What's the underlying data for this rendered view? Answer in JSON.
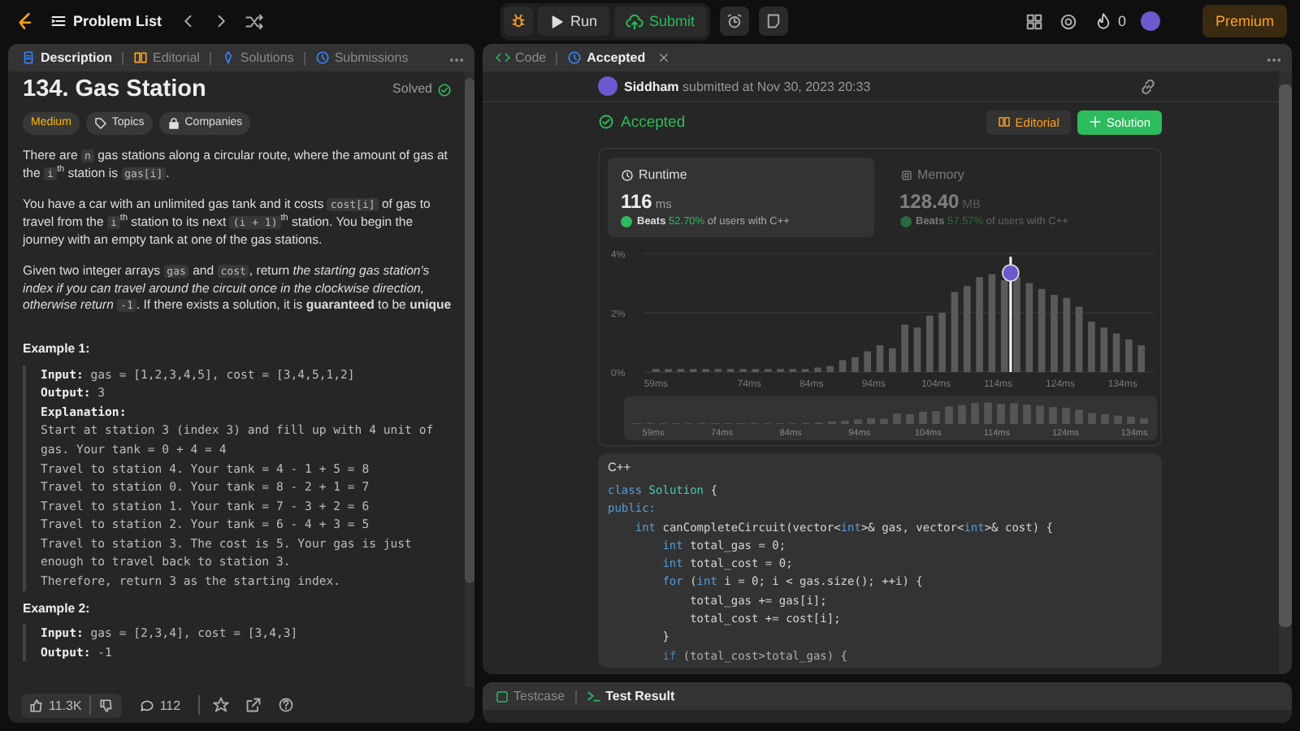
{
  "top_bar": {
    "problem_list": "Problem List",
    "run": "Run",
    "submit": "Submit",
    "streak": "0",
    "premium": "Premium"
  },
  "left_panel": {
    "tabs": [
      {
        "label": "Description",
        "selected": true
      },
      {
        "label": "Editorial",
        "selected": false
      },
      {
        "label": "Solutions",
        "selected": false
      },
      {
        "label": "Submissions",
        "selected": false
      }
    ],
    "title": "134. Gas Station",
    "status": "Solved",
    "difficulty": "Medium",
    "tags": [
      "Topics",
      "Companies"
    ],
    "paragraphs": [
      [
        {
          "text": "There are ",
          "kind": "text"
        },
        {
          "text": "n",
          "kind": "code"
        },
        {
          "text": " gas stations along a circular route, where the amount of gas at the ",
          "kind": "text"
        },
        {
          "text": "i",
          "kind": "code"
        },
        {
          "text": "th",
          "kind": "sup"
        },
        {
          "text": " station is ",
          "kind": "text"
        },
        {
          "text": "gas[i]",
          "kind": "code"
        },
        {
          "text": ".",
          "kind": "text"
        }
      ],
      [
        {
          "text": "You have a car with an unlimited gas tank and it costs ",
          "kind": "text"
        },
        {
          "text": "cost[i]",
          "kind": "code"
        },
        {
          "text": " of gas to travel from the ",
          "kind": "text"
        },
        {
          "text": "i",
          "kind": "code"
        },
        {
          "text": "th",
          "kind": "sup"
        },
        {
          "text": " station to its next ",
          "kind": "text"
        },
        {
          "text": "(i + 1)",
          "kind": "code"
        },
        {
          "text": "th",
          "kind": "sup"
        },
        {
          "text": " station. You begin the journey with an empty tank at one of the gas stations.",
          "kind": "text"
        }
      ],
      [
        {
          "text": "Given two integer arrays ",
          "kind": "text"
        },
        {
          "text": "gas",
          "kind": "code"
        },
        {
          "text": " and ",
          "kind": "text"
        },
        {
          "text": "cost",
          "kind": "code"
        },
        {
          "text": ", return ",
          "kind": "text"
        },
        {
          "text": "the starting gas station's index if you can travel around the circuit once in the clockwise direction, otherwise return ",
          "kind": "italic"
        },
        {
          "text": "-1",
          "kind": "code"
        },
        {
          "text": ". If there exists a solution, it is ",
          "kind": "text"
        },
        {
          "text": "guaranteed",
          "kind": "bold"
        },
        {
          "text": " to be ",
          "kind": "text"
        },
        {
          "text": "unique",
          "kind": "bold"
        }
      ]
    ],
    "examples": [
      {
        "heading": "Example 1:",
        "lines": [
          {
            "label": "Input:",
            "text": " gas = [1,2,3,4,5], cost = [3,4,5,1,2]"
          },
          {
            "label": "Output:",
            "text": " 3"
          },
          {
            "label": "Explanation:"
          },
          {
            "text": "Start at station 3 (index 3) and fill up with 4 unit of"
          },
          {
            "text": "gas. Your tank = 0 + 4 = 4"
          },
          {
            "text": "Travel to station 4. Your tank = 4 - 1 + 5 = 8"
          },
          {
            "text": "Travel to station 0. Your tank = 8 - 2 + 1 = 7"
          },
          {
            "text": "Travel to station 1. Your tank = 7 - 3 + 2 = 6"
          },
          {
            "text": "Travel to station 2. Your tank = 6 - 4 + 3 = 5"
          },
          {
            "text": "Travel to station 3. The cost is 5. Your gas is just"
          },
          {
            "text": "enough to travel back to station 3."
          },
          {
            "text": "Therefore, return 3 as the starting index."
          }
        ]
      },
      {
        "heading": "Example 2:",
        "lines": [
          {
            "label": "Input:",
            "text": " gas = [2,3,4], cost = [3,4,3]"
          },
          {
            "label": "Output:",
            "text": " -1"
          }
        ]
      }
    ],
    "footer": {
      "likes": "11.3K",
      "comments": "112"
    }
  },
  "right_panel": {
    "tabs": [
      {
        "label": "Code",
        "selected": false
      },
      {
        "label": "Accepted",
        "selected": true
      }
    ],
    "submitter": "Siddham",
    "submitted_text": "submitted at Nov 30, 2023 20:33",
    "status": "Accepted",
    "editorial_button": "Editorial",
    "solution_button": "Solution",
    "stats": [
      {
        "title": "Runtime",
        "value": "116",
        "unit": "ms",
        "beats_label": "Beats",
        "percent": "52.70%",
        "suffix": "of users with C++",
        "selected": true
      },
      {
        "title": "Memory",
        "value": "128.40",
        "unit": "MB",
        "beats_label": "Beats",
        "percent": "57.57%",
        "suffix": "of users with C++",
        "selected": false
      }
    ],
    "chart_data": {
      "type": "bar",
      "x": [
        59,
        61,
        63,
        65,
        67,
        69,
        71,
        73,
        75,
        77,
        79,
        81,
        83,
        85,
        87,
        89,
        91,
        93,
        95,
        97,
        99,
        101,
        103,
        105,
        107,
        109,
        111,
        113,
        115,
        117,
        119,
        121,
        123,
        125,
        127,
        129,
        131,
        133,
        135,
        137
      ],
      "values": [
        0.1,
        0.1,
        0.1,
        0.1,
        0.1,
        0.1,
        0.1,
        0.1,
        0.1,
        0.1,
        0.1,
        0.1,
        0.1,
        0.15,
        0.2,
        0.4,
        0.5,
        0.7,
        0.9,
        0.8,
        1.6,
        1.5,
        1.9,
        2.0,
        2.7,
        2.9,
        3.2,
        3.3,
        3.1,
        3.2,
        3.0,
        2.8,
        2.6,
        2.5,
        2.2,
        1.7,
        1.5,
        1.3,
        1.1,
        0.9
      ],
      "xlim": [
        57,
        139
      ],
      "ylim": [
        0,
        4
      ],
      "xticks": [
        {
          "value": 59,
          "label": "59ms"
        },
        {
          "value": 74,
          "label": "74ms"
        },
        {
          "value": 84,
          "label": "84ms"
        },
        {
          "value": 94,
          "label": "94ms"
        },
        {
          "value": 104,
          "label": "104ms"
        },
        {
          "value": 114,
          "label": "114ms"
        },
        {
          "value": 124,
          "label": "124ms"
        },
        {
          "value": 134,
          "label": "134ms"
        }
      ],
      "yticks": [
        {
          "value": 0,
          "label": "0%"
        },
        {
          "value": 2,
          "label": "2%"
        },
        {
          "value": 4,
          "label": "4%"
        }
      ],
      "ref_lines": [
        {
          "axis": "x",
          "value": 116
        }
      ]
    },
    "overview_labels": [
      "59ms",
      "74ms",
      "84ms",
      "94ms",
      "104ms",
      "114ms",
      "124ms",
      "134ms"
    ],
    "language": "C++",
    "code": [
      [
        {
          "text": "class ",
          "kind": "kw"
        },
        {
          "text": "Solution",
          "kind": "type"
        },
        {
          "text": " {",
          "kind": "plain"
        }
      ],
      [
        {
          "text": "public:",
          "kind": "kw"
        }
      ],
      [
        {
          "text": "    int",
          "kind": "kw"
        },
        {
          "text": " canCompleteCircuit(vector<",
          "kind": "plain"
        },
        {
          "text": "int",
          "kind": "kw"
        },
        {
          "text": ">& gas, vector<",
          "kind": "plain"
        },
        {
          "text": "int",
          "kind": "kw"
        },
        {
          "text": ">& cost) {",
          "kind": "plain"
        }
      ],
      [
        {
          "text": "        int",
          "kind": "kw"
        },
        {
          "text": " total_gas = 0;",
          "kind": "plain"
        }
      ],
      [
        {
          "text": "        int",
          "kind": "kw"
        },
        {
          "text": " total_cost = 0;",
          "kind": "plain"
        }
      ],
      [
        {
          "text": "        for",
          "kind": "kw"
        },
        {
          "text": " (",
          "kind": "plain"
        },
        {
          "text": "int",
          "kind": "kw"
        },
        {
          "text": " i = 0; i < gas.size(); ++i) {",
          "kind": "plain"
        }
      ],
      [
        {
          "text": "            total_gas += gas[i];",
          "kind": "plain"
        }
      ],
      [
        {
          "text": "            total_cost += cost[i];",
          "kind": "plain"
        }
      ],
      [
        {
          "text": "        }",
          "kind": "plain"
        }
      ],
      [
        {
          "text": "        if",
          "kind": "kw"
        },
        {
          "text": " (total_cost>total_gas) {",
          "kind": "plain"
        }
      ]
    ],
    "bottom_tabs": [
      {
        "label": "Testcase",
        "selected": false
      },
      {
        "label": "Test Result",
        "selected": true
      }
    ]
  }
}
